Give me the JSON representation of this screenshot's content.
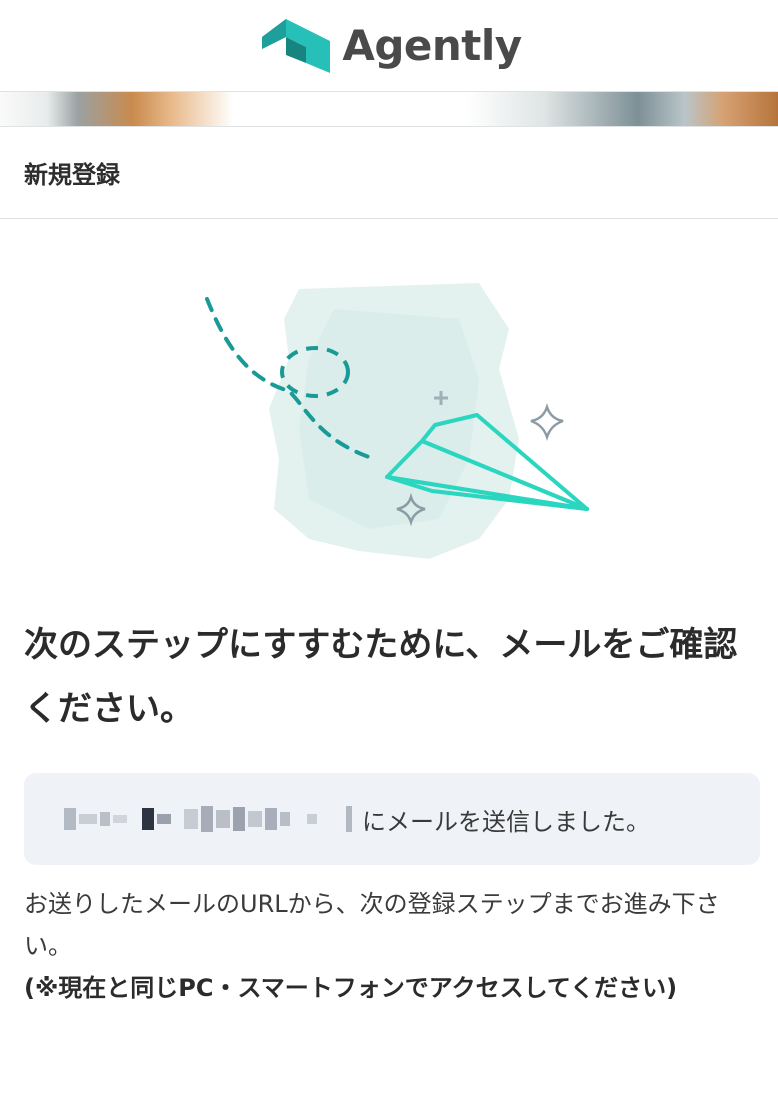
{
  "header": {
    "logo_text": "Agently"
  },
  "section_title": "新規登録",
  "headline": "次のステップにすすむために、メールをご確認ください。",
  "notice": {
    "text": "にメールを送信しました。"
  },
  "body": {
    "instruction": "お送りしたメールのURLから、次の登録ステップまでお進み下さい。",
    "note": "(※現在と同じPC・スマートフォンでアクセスしてください)"
  },
  "colors": {
    "brand_teal": "#27c0b8",
    "brand_dark_teal": "#1a9a96",
    "text": "#2b2b2b",
    "notice_bg": "#eff3f7"
  }
}
